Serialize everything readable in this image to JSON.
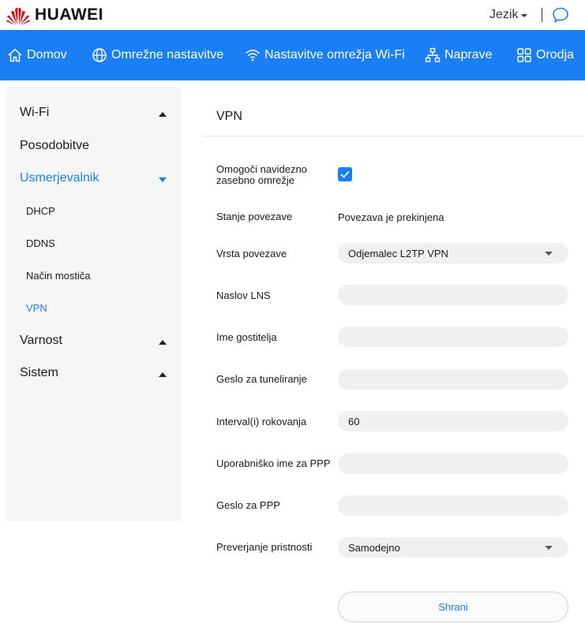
{
  "brand": {
    "name": "HUAWEI",
    "logo_icon": "huawei-logo-icon",
    "logo_color": "#e60012"
  },
  "header": {
    "language_label": "Jezik",
    "chat_icon": "chat-bubble-icon"
  },
  "nav": {
    "background": "#1a7ef5",
    "items": [
      {
        "label": "Domov",
        "icon": "home-icon"
      },
      {
        "label": "Omrežne nastavitve",
        "icon": "globe-icon"
      },
      {
        "label": "Nastavitve omrežja Wi-Fi",
        "icon": "wifi-icon"
      },
      {
        "label": "Naprave",
        "icon": "network-devices-icon"
      },
      {
        "label": "Orodja",
        "icon": "tools-grid-icon"
      }
    ]
  },
  "sidebar": {
    "items": [
      {
        "label": "Wi-Fi",
        "expanded": false
      },
      {
        "label": "Posodobitve"
      },
      {
        "label": "Usmerjevalnik",
        "expanded": true,
        "active": true
      },
      {
        "label": "DHCP"
      },
      {
        "label": "DDNS"
      },
      {
        "label": "Način mostiča"
      },
      {
        "label": "VPN",
        "active": true
      },
      {
        "label": "Varnost",
        "expanded": false
      },
      {
        "label": "Sistem",
        "expanded": false
      }
    ]
  },
  "main": {
    "title": "VPN",
    "enable_vpn": {
      "label": "Omogoči navidezno zasebno omrežje",
      "checked": true
    },
    "status": {
      "label": "Stanje povezave",
      "value": "Povezava je prekinjena"
    },
    "connection_type": {
      "label": "Vrsta povezave",
      "value": "Odjemalec L2TP VPN"
    },
    "lns_address": {
      "label": "Naslov LNS",
      "value": ""
    },
    "host_name": {
      "label": "Ime gostitelja",
      "value": ""
    },
    "tunnel_password": {
      "label": "Geslo za tuneliranje",
      "value": ""
    },
    "handshake_interval": {
      "label": "Interval(i) rokovanja",
      "value": "60"
    },
    "ppp_username": {
      "label": "Uporabniško ime za PPP",
      "value": ""
    },
    "ppp_password": {
      "label": "Geslo za PPP",
      "value": ""
    },
    "authentication": {
      "label": "Preverjanje pristnosti",
      "value": "Samodejno"
    },
    "save_label": "Shrani"
  }
}
